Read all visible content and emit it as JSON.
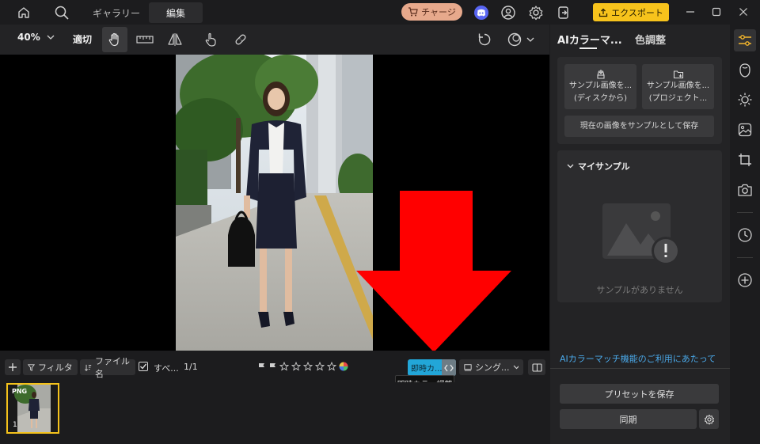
{
  "titlebar": {
    "tabs": [
      {
        "label": "ギャラリー",
        "active": false
      },
      {
        "label": "編集",
        "active": true
      }
    ],
    "charge_label": "チャージ",
    "export_label": "エクスポート"
  },
  "toolbar": {
    "zoom": "40%",
    "fit_label": "適切"
  },
  "filterbar": {
    "filter_label": "フィルタ...",
    "sort_label": "ファイル名",
    "select_all_label": "すべ...",
    "count": "1/1",
    "instant_label": "即時カ...",
    "view_label": "シング..."
  },
  "tooltip": "即時カラー調整",
  "filmstrip": {
    "items": [
      {
        "tag": "PNG",
        "index": "1"
      }
    ]
  },
  "panel": {
    "tabs": [
      {
        "label": "AIカラーマ...",
        "active": true
      },
      {
        "label": "色調整",
        "active": false
      }
    ],
    "sample_disk": [
      "サンプル画像を...",
      "(ディスクから)"
    ],
    "sample_project": [
      "サンプル画像を...",
      "(プロジェクト..."
    ],
    "save_current": "現在の画像をサンプルとして保存",
    "my_samples_title": "マイサンプル",
    "no_samples": "サンプルがありません",
    "info_link": "AIカラーマッチ機能のご利用にあたって",
    "save_preset": "プリセットを保存",
    "sync": "同期"
  },
  "colors": {
    "accent_yellow": "#f7c31c",
    "instant_blue": "#22a6d8",
    "arrow_red": "#ff0000",
    "link_blue": "#4aa8e8"
  }
}
